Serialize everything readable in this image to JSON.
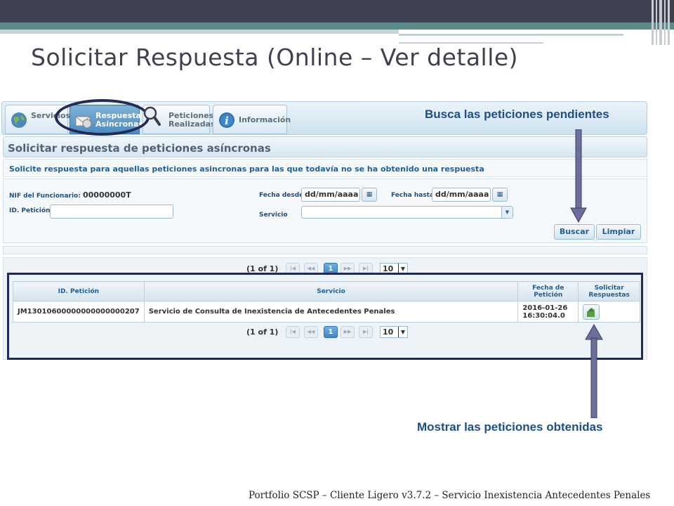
{
  "slide": {
    "title": "Solicitar Respuesta (Online – Ver detalle)",
    "footer": "Portfolio SCSP – Cliente Ligero v3.7.2 – Servicio  Inexistencia Antecedentes Penales"
  },
  "tabs": [
    {
      "label": "Servicios",
      "icon": "globe-icon"
    },
    {
      "label": "Respuestas\nAsíncronas",
      "icon": "envelope-clock-icon",
      "active": true
    },
    {
      "label": "Peticiones\nRealizadas",
      "icon": "magnifier-icon"
    },
    {
      "label": "Información",
      "icon": "info-icon"
    }
  ],
  "annotations": {
    "search_note": "Busca las peticiones pendientes",
    "results_note": "Mostrar las peticiones obtenidas"
  },
  "section": {
    "title": "Solicitar respuesta de peticiones asíncronas",
    "info": "Solicite respuesta para aquellas peticiones asincronas para las que todavía no se ha obtenido una respuesta"
  },
  "form": {
    "nif_label": "NIF del Funcionario:",
    "nif_value": "00000000T",
    "id_label": "ID. Petición",
    "id_value": "",
    "fecha_desde_label": "Fecha desde",
    "fecha_desde_value": "dd/mm/aaaa",
    "fecha_hasta_label": "Fecha hasta",
    "fecha_hasta_value": "dd/mm/aaaa",
    "servicio_label": "Servicio",
    "servicio_value": "",
    "buscar_label": "Buscar",
    "limpiar_label": "Limpiar"
  },
  "pagination": {
    "text": "(1 of 1)",
    "current_page": "1",
    "first": "|◀",
    "prev": "◀◀",
    "next": "▶▶",
    "last": "▶|",
    "rows_per_page": "10"
  },
  "table": {
    "columns": [
      "ID. Petición",
      "Servicio",
      "Fecha de Petición",
      "Solicitar Respuestas"
    ],
    "rows": [
      {
        "id": "JM13010600000000000000207",
        "servicio": "Servicio de Consulta de Inexistencia de Antecedentes Penales",
        "fecha_line1": "2016-01-26",
        "fecha_line2": "16:30:04.0",
        "action_icon": "request-response-icon"
      }
    ]
  },
  "colors": {
    "accent_blue": "#1d4f8a",
    "title_gray": "#3f4150",
    "overlay_navy": "#1c2a5e"
  }
}
